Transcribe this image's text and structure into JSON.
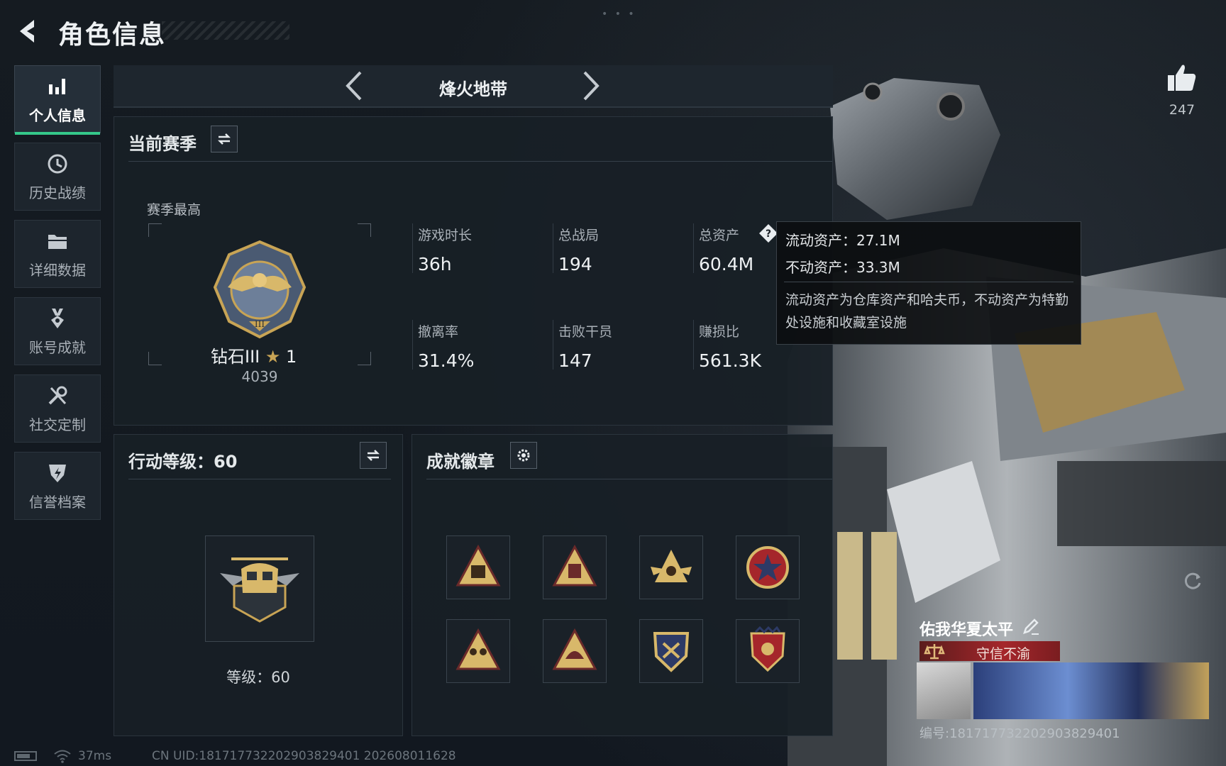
{
  "header": {
    "title": "角色信息"
  },
  "sidebar": {
    "items": [
      {
        "label": "个人信息",
        "icon": "bar-chart-icon",
        "active": true
      },
      {
        "label": "历史战绩",
        "icon": "history-clock-icon"
      },
      {
        "label": "详细数据",
        "icon": "folder-icon"
      },
      {
        "label": "账号成就",
        "icon": "medal-icon"
      },
      {
        "label": "社交定制",
        "icon": "tools-icon"
      },
      {
        "label": "信誉档案",
        "icon": "shield-lightning-icon"
      }
    ]
  },
  "mode": {
    "title": "烽火地带"
  },
  "season": {
    "title": "当前赛季",
    "best_label": "赛季最高",
    "rank_name": "钻石III",
    "rank_stars": "1",
    "rank_score": "4039",
    "stats": [
      {
        "label": "游戏时长",
        "value": "36h"
      },
      {
        "label": "总战局",
        "value": "194"
      },
      {
        "label": "总资产",
        "value": "60.4M"
      },
      {
        "label": "撤离率",
        "value": "31.4%"
      },
      {
        "label": "击败干员",
        "value": "147"
      },
      {
        "label": "赚损比",
        "value": "561.3K"
      }
    ]
  },
  "tooltip": {
    "liquid": "流动资产：27.1M",
    "fixed": "不动资产：33.3M",
    "desc": "流动资产为仓库资产和哈夫币，不动资产为特勤处设施和收藏室设施"
  },
  "action_level": {
    "title": "行动等级：60",
    "level_text": "等级：60"
  },
  "badges": {
    "title": "成就徽章"
  },
  "likes": {
    "count": "247"
  },
  "player": {
    "name": "佑我华夏太平",
    "honor": "守信不渝",
    "id": "编号:181717732202903829401"
  },
  "footer": {
    "ping": "37ms",
    "uid": "CN UID:181717732202903829401 202608011628"
  },
  "colors": {
    "accent_green": "#35c88a",
    "honor_red": "#a5262b",
    "gold": "#c8a455"
  }
}
